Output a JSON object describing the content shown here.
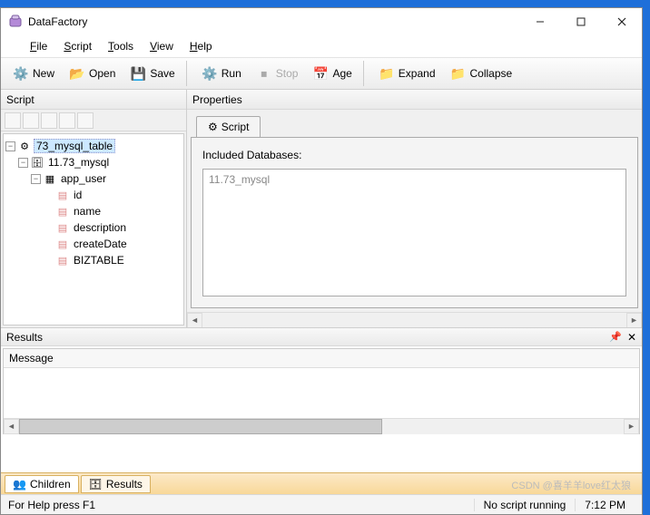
{
  "app": {
    "title": "DataFactory"
  },
  "menu": {
    "file": "File",
    "script": "Script",
    "tools": "Tools",
    "view": "View",
    "help": "Help"
  },
  "toolbar": {
    "new": "New",
    "open": "Open",
    "save": "Save",
    "run": "Run",
    "stop": "Stop",
    "age": "Age",
    "expand": "Expand",
    "collapse": "Collapse"
  },
  "panels": {
    "script_title": "Script",
    "properties_title": "Properties",
    "prop_tab": "Script",
    "included_db_label": "Included Databases:",
    "db_list_item": "11.73_mysql"
  },
  "tree": {
    "root": "73_mysql_table",
    "db": "11.73_mysql",
    "table": "app_user",
    "cols": [
      "id",
      "name",
      "description",
      "createDate",
      "BIZTABLE"
    ]
  },
  "results": {
    "title": "Results",
    "message_header": "Message"
  },
  "bottom_tabs": {
    "children": "Children",
    "results": "Results"
  },
  "status": {
    "help": "For Help press F1",
    "running": "No script running",
    "time": "7:12 PM"
  },
  "watermark": "CSDN @喜羊羊love红太狼"
}
